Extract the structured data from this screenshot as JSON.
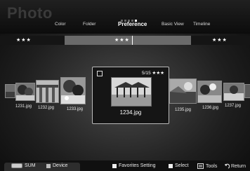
{
  "header": {
    "app_title": "Photo",
    "tabs": [
      "Color",
      "Folder",
      "Preference",
      "Basic View",
      "Timeline"
    ],
    "active_tab": "Preference"
  },
  "rating_bar": {
    "left": "★★★",
    "center": "★★★",
    "right": "★★★"
  },
  "photos": [
    "1231.jpg",
    "1232.jpg",
    "1233.jpg",
    "1234.jpg",
    "1235.jpg",
    "1236.jpg",
    "1237.jpg"
  ],
  "selected": {
    "counter": "5/15 ★★★",
    "filename": "1234.jpg"
  },
  "bottom_bar": {
    "sum": "SUM",
    "device": "Device",
    "favorites": "Favorites Setting",
    "select": "Select",
    "tools": "Tools",
    "return": "Return"
  },
  "colors": {
    "accent_active": "#ffffff",
    "rating_highlight": "#6a6a6a"
  }
}
